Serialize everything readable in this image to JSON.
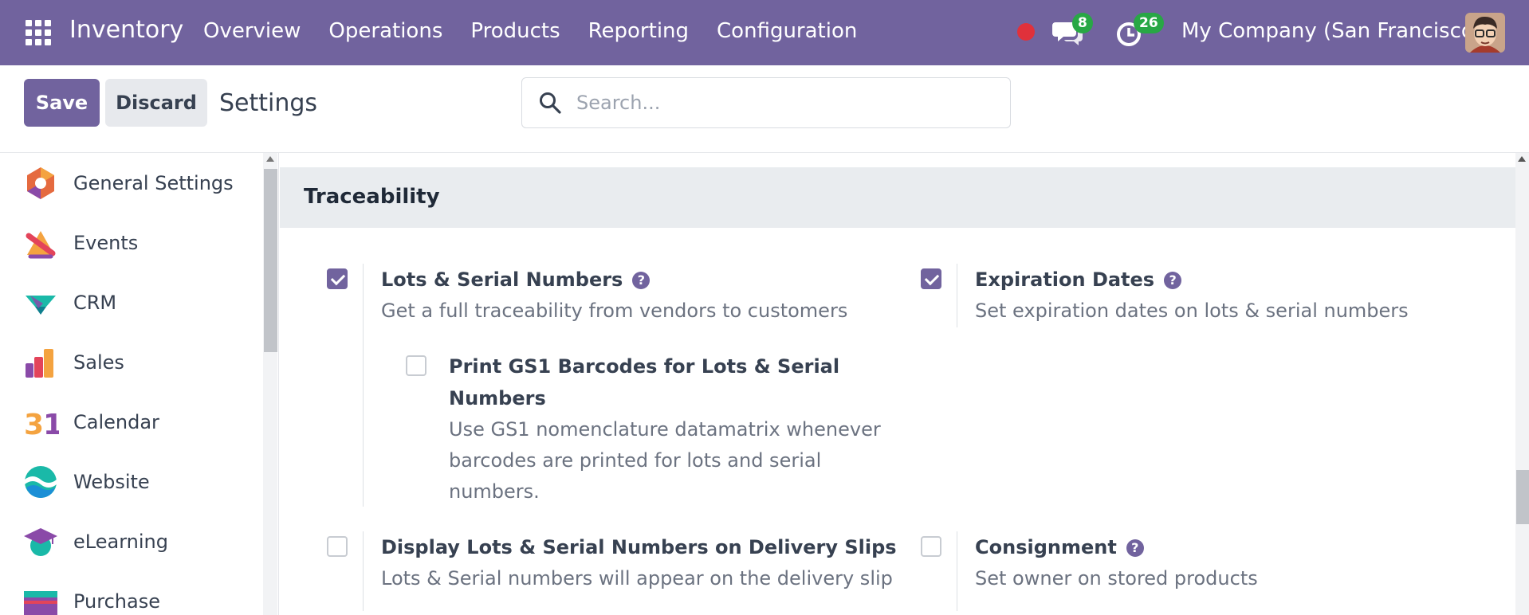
{
  "navbar": {
    "app_name": "Inventory",
    "menu": [
      "Overview",
      "Operations",
      "Products",
      "Reporting",
      "Configuration"
    ],
    "messages_count": "8",
    "activities_count": "26",
    "company": "My Company (San Francisco)",
    "brand_color": "#71639e"
  },
  "control": {
    "save_label": "Save",
    "discard_label": "Discard",
    "title": "Settings",
    "search_placeholder": "Search..."
  },
  "sidebar": {
    "items": [
      {
        "label": "General Settings",
        "icon": "general-settings-icon"
      },
      {
        "label": "Events",
        "icon": "events-icon"
      },
      {
        "label": "CRM",
        "icon": "crm-icon"
      },
      {
        "label": "Sales",
        "icon": "sales-icon"
      },
      {
        "label": "Calendar",
        "icon": "calendar-icon"
      },
      {
        "label": "Website",
        "icon": "website-icon"
      },
      {
        "label": "eLearning",
        "icon": "elearning-icon"
      },
      {
        "label": "Purchase",
        "icon": "purchase-icon"
      }
    ]
  },
  "section": {
    "title": "Traceability",
    "settings": {
      "lots": {
        "title": "Lots & Serial Numbers",
        "desc": "Get a full traceability from vendors to customers",
        "checked": true
      },
      "gs1": {
        "title_1": "Print GS1 Barcodes for Lots & Serial",
        "title_2": "Numbers",
        "desc_1": "Use GS1 nomenclature datamatrix whenever",
        "desc_2": "barcodes are printed for lots and serial",
        "desc_3": "numbers.",
        "checked": false
      },
      "expiration": {
        "title": "Expiration Dates",
        "desc": "Set expiration dates on lots & serial numbers",
        "checked": true
      },
      "delivery": {
        "title": "Display Lots & Serial Numbers on Delivery Slips",
        "desc": "Lots & Serial numbers will appear on the delivery slip",
        "checked": false
      },
      "consignment": {
        "title": "Consignment",
        "desc": "Set owner on stored products",
        "checked": false
      }
    }
  }
}
